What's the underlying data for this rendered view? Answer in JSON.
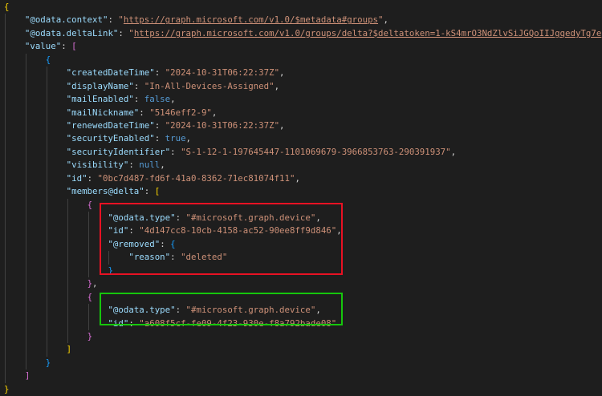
{
  "colors": {
    "key": "#9cdcfe",
    "string": "#ce9178",
    "keyword": "#569cd6",
    "punct": "#d4d4d4",
    "highlight_removed": "#e81123",
    "highlight_added": "#16c60c"
  },
  "lines": [
    {
      "indent": 0,
      "tokens": [
        [
          "br0",
          "{"
        ]
      ]
    },
    {
      "indent": 1,
      "tokens": [
        [
          "k",
          "\"@odata.context\""
        ],
        [
          "p",
          ": "
        ],
        [
          "s",
          "\""
        ],
        [
          "s u",
          "https://graph.microsoft.com/v1.0/$metadata#groups"
        ],
        [
          "s",
          "\""
        ],
        [
          "p",
          ","
        ]
      ]
    },
    {
      "indent": 1,
      "tokens": [
        [
          "k",
          "\"@odata.deltaLink\""
        ],
        [
          "p",
          ": "
        ],
        [
          "s",
          "\""
        ],
        [
          "s u",
          "https://graph.microsoft.com/v1.0/groups/delta?$deltatoken=1-kS4mrO3NdZlvSiJGQoIIJgqedyTg7e"
        ]
      ]
    },
    {
      "indent": 1,
      "tokens": [
        [
          "k",
          "\"value\""
        ],
        [
          "p",
          ": "
        ],
        [
          "br1",
          "["
        ]
      ]
    },
    {
      "indent": 2,
      "tokens": [
        [
          "br2",
          "{"
        ]
      ]
    },
    {
      "indent": 3,
      "tokens": [
        [
          "k",
          "\"createdDateTime\""
        ],
        [
          "p",
          ": "
        ],
        [
          "s",
          "\"2024-10-31T06:22:37Z\""
        ],
        [
          "p",
          ","
        ]
      ]
    },
    {
      "indent": 3,
      "tokens": [
        [
          "k",
          "\"displayName\""
        ],
        [
          "p",
          ": "
        ],
        [
          "s",
          "\"In-All-Devices-Assigned\""
        ],
        [
          "p",
          ","
        ]
      ]
    },
    {
      "indent": 3,
      "tokens": [
        [
          "k",
          "\"mailEnabled\""
        ],
        [
          "p",
          ": "
        ],
        [
          "b",
          "false"
        ],
        [
          "p",
          ","
        ]
      ]
    },
    {
      "indent": 3,
      "tokens": [
        [
          "k",
          "\"mailNickname\""
        ],
        [
          "p",
          ": "
        ],
        [
          "s",
          "\"5146eff2-9\""
        ],
        [
          "p",
          ","
        ]
      ]
    },
    {
      "indent": 3,
      "tokens": [
        [
          "k",
          "\"renewedDateTime\""
        ],
        [
          "p",
          ": "
        ],
        [
          "s",
          "\"2024-10-31T06:22:37Z\""
        ],
        [
          "p",
          ","
        ]
      ]
    },
    {
      "indent": 3,
      "tokens": [
        [
          "k",
          "\"securityEnabled\""
        ],
        [
          "p",
          ": "
        ],
        [
          "b",
          "true"
        ],
        [
          "p",
          ","
        ]
      ]
    },
    {
      "indent": 3,
      "tokens": [
        [
          "k",
          "\"securityIdentifier\""
        ],
        [
          "p",
          ": "
        ],
        [
          "s",
          "\"S-1-12-1-197645447-1101069679-3966853763-290391937\""
        ],
        [
          "p",
          ","
        ]
      ]
    },
    {
      "indent": 3,
      "tokens": [
        [
          "k",
          "\"visibility\""
        ],
        [
          "p",
          ": "
        ],
        [
          "b",
          "null"
        ],
        [
          "p",
          ","
        ]
      ]
    },
    {
      "indent": 3,
      "tokens": [
        [
          "k",
          "\"id\""
        ],
        [
          "p",
          ": "
        ],
        [
          "s",
          "\"0bc7d487-fd6f-41a0-8362-71ec81074f11\""
        ],
        [
          "p",
          ","
        ]
      ]
    },
    {
      "indent": 3,
      "tokens": [
        [
          "k",
          "\"members@delta\""
        ],
        [
          "p",
          ": "
        ],
        [
          "br0",
          "["
        ]
      ]
    },
    {
      "indent": 4,
      "tokens": [
        [
          "br1",
          "{"
        ]
      ]
    },
    {
      "indent": 5,
      "tokens": [
        [
          "k",
          "\"@odata.type\""
        ],
        [
          "p",
          ": "
        ],
        [
          "s",
          "\"#microsoft.graph.device\""
        ],
        [
          "p",
          ","
        ]
      ]
    },
    {
      "indent": 5,
      "tokens": [
        [
          "k",
          "\"id\""
        ],
        [
          "p",
          ": "
        ],
        [
          "s",
          "\"4d147cc8-10cb-4158-ac52-90ee8ff9d846\""
        ],
        [
          "p",
          ","
        ]
      ]
    },
    {
      "indent": 5,
      "tokens": [
        [
          "k",
          "\"@removed\""
        ],
        [
          "p",
          ": "
        ],
        [
          "br2",
          "{"
        ]
      ]
    },
    {
      "indent": 6,
      "tokens": [
        [
          "k",
          "\"reason\""
        ],
        [
          "p",
          ": "
        ],
        [
          "s",
          "\"deleted\""
        ]
      ]
    },
    {
      "indent": 5,
      "tokens": [
        [
          "br2",
          "}"
        ]
      ]
    },
    {
      "indent": 4,
      "tokens": [
        [
          "br1",
          "}"
        ],
        [
          "p",
          ","
        ]
      ]
    },
    {
      "indent": 4,
      "tokens": [
        [
          "br1",
          "{"
        ]
      ]
    },
    {
      "indent": 5,
      "tokens": [
        [
          "k",
          "\"@odata.type\""
        ],
        [
          "p",
          ": "
        ],
        [
          "s",
          "\"#microsoft.graph.device\""
        ],
        [
          "p",
          ","
        ]
      ]
    },
    {
      "indent": 5,
      "tokens": [
        [
          "k",
          "\"id\""
        ],
        [
          "p",
          ": "
        ],
        [
          "s",
          "\"a608f5cf-fe09-4f23-930e-f8a792bade08\""
        ]
      ]
    },
    {
      "indent": 4,
      "tokens": [
        [
          "br1",
          "}"
        ]
      ]
    },
    {
      "indent": 3,
      "tokens": [
        [
          "br0",
          "]"
        ]
      ]
    },
    {
      "indent": 2,
      "tokens": [
        [
          "br2",
          "}"
        ]
      ]
    },
    {
      "indent": 1,
      "tokens": [
        [
          "br1",
          "]"
        ]
      ]
    },
    {
      "indent": 0,
      "tokens": [
        [
          "br0",
          "}"
        ]
      ]
    }
  ]
}
